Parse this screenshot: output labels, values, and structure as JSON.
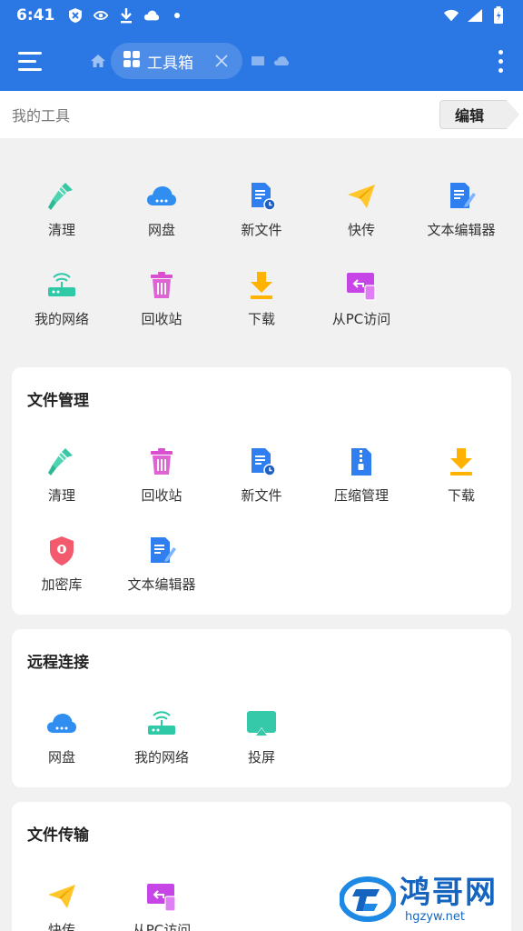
{
  "status_bar": {
    "time": "6:41"
  },
  "app_bar": {
    "tab_label": "工具箱"
  },
  "my_tools": {
    "label": "我的工具",
    "edit_label": "编辑",
    "items": [
      {
        "label": "清理",
        "icon": "broom-icon"
      },
      {
        "label": "网盘",
        "icon": "cloud-drive-icon"
      },
      {
        "label": "新文件",
        "icon": "new-file-icon"
      },
      {
        "label": "快传",
        "icon": "paper-plane-icon"
      },
      {
        "label": "文本编辑器",
        "icon": "text-editor-icon"
      },
      {
        "label": "我的网络",
        "icon": "router-icon"
      },
      {
        "label": "回收站",
        "icon": "trash-icon"
      },
      {
        "label": "下载",
        "icon": "download-icon"
      },
      {
        "label": "从PC访问",
        "icon": "pc-access-icon"
      }
    ]
  },
  "file_management": {
    "title": "文件管理",
    "items": [
      {
        "label": "清理",
        "icon": "broom-icon"
      },
      {
        "label": "回收站",
        "icon": "trash-icon"
      },
      {
        "label": "新文件",
        "icon": "new-file-icon"
      },
      {
        "label": "压缩管理",
        "icon": "zip-icon"
      },
      {
        "label": "下载",
        "icon": "download-icon"
      },
      {
        "label": "加密库",
        "icon": "shield-lock-icon"
      },
      {
        "label": "文本编辑器",
        "icon": "text-editor-icon"
      }
    ]
  },
  "remote": {
    "title": "远程连接",
    "items": [
      {
        "label": "网盘",
        "icon": "cloud-drive-icon"
      },
      {
        "label": "我的网络",
        "icon": "router-icon"
      },
      {
        "label": "投屏",
        "icon": "cast-screen-icon"
      }
    ]
  },
  "transfer": {
    "title": "文件传输",
    "items": [
      {
        "label": "快传",
        "icon": "paper-plane-icon"
      },
      {
        "label": "从PC访问",
        "icon": "pc-access-icon"
      }
    ]
  },
  "watermark": {
    "brand": "鸿哥网",
    "url": "hgzyw.net"
  },
  "colors": {
    "primary": "#2b78e4",
    "background": "#f1f1f1",
    "brand": "#1565c0"
  }
}
